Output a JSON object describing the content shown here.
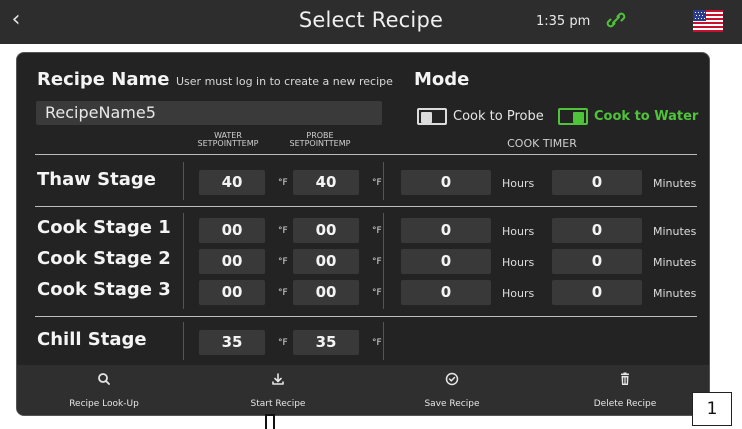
{
  "header": {
    "back_icon": "chevron-left-icon",
    "title": "Select Recipe",
    "time": "1:35 pm",
    "link_icon": "link-icon",
    "link_color": "#4fc33a",
    "flag_icon": "us-flag-icon"
  },
  "recipe": {
    "name_label": "Recipe Name",
    "name_hint": "User must log in to create a new recipe",
    "name_value": "RecipeName5"
  },
  "mode": {
    "label": "Mode",
    "options": [
      {
        "label": "Cook to Probe",
        "selected": false
      },
      {
        "label": "Cook to Water",
        "selected": true
      }
    ],
    "accent": "#4fc33a"
  },
  "columns": {
    "water_line1": "WATER",
    "water_line2": "SETPOINTTEMP",
    "probe_line1": "PROBE",
    "probe_line2": "SETPOINTTEMP",
    "cook_timer": "COOK TIMER"
  },
  "units": {
    "deg": "°F",
    "hours": "Hours",
    "minutes": "Minutes"
  },
  "stages": [
    {
      "label": "Thaw Stage",
      "water": "40",
      "probe": "40",
      "hours": "0",
      "minutes": "0"
    },
    {
      "label": "Cook Stage 1",
      "water": "00",
      "probe": "00",
      "hours": "0",
      "minutes": "0"
    },
    {
      "label": "Cook Stage 2",
      "water": "00",
      "probe": "00",
      "hours": "0",
      "minutes": "0"
    },
    {
      "label": "Cook Stage 3",
      "water": "00",
      "probe": "00",
      "hours": "0",
      "minutes": "0"
    },
    {
      "label": "Chill Stage",
      "water": "35",
      "probe": "35"
    }
  ],
  "actions": [
    {
      "label": "Recipe Look-Up",
      "icon": "search-icon"
    },
    {
      "label": "Start Recipe",
      "icon": "download-icon"
    },
    {
      "label": "Save Recipe",
      "icon": "check-circle-icon"
    },
    {
      "label": "Delete Recipe",
      "icon": "trash-icon"
    }
  ],
  "callout": {
    "number": "1"
  }
}
